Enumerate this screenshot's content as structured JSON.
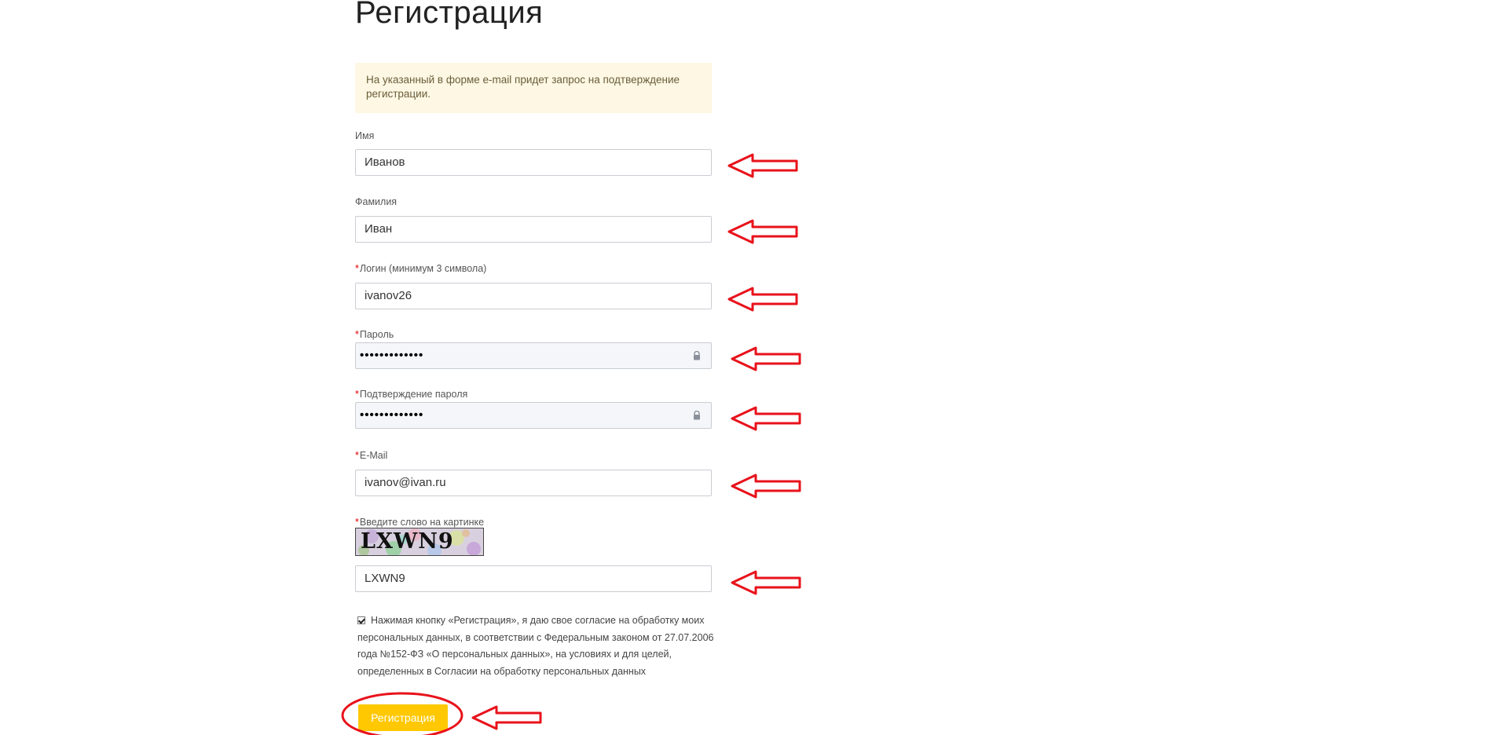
{
  "page": {
    "title": "Регистрация",
    "notice": "На указанный в форме e-mail придет запрос на подтверждение регистрации."
  },
  "form": {
    "fields": [
      {
        "label": "Имя",
        "required": false,
        "value": "Иванов",
        "type": "text"
      },
      {
        "label": "Фамилия",
        "required": false,
        "value": "Иван",
        "type": "text"
      },
      {
        "label": "Логин (минимум 3 символа)",
        "required": true,
        "value": "ivanov26",
        "type": "text"
      },
      {
        "label": "Пароль",
        "required": true,
        "value": "•••••••••••••",
        "type": "password"
      },
      {
        "label": "Подтверждение пароля",
        "required": true,
        "value": "•••••••••••••",
        "type": "password"
      },
      {
        "label": "E-Mail",
        "required": true,
        "value": "ivanov@ivan.ru",
        "type": "text"
      }
    ],
    "captcha": {
      "label": "Введите слово на картинке",
      "required": true,
      "image_text": "LXWN9",
      "value": "LXWN9"
    },
    "required_mark": "*",
    "consent": {
      "checked": true,
      "text": "Нажимая кнопку «Регистрация», я даю свое согласие на обработку моих персональных данных, в соответствии с Федеральным законом от 27.07.2006 года №152-ФЗ «О персональных данных», на условиях и для целей, определенных в Согласии на обработку персональных данных"
    },
    "submit_label": "Регистрация"
  },
  "colors": {
    "accent": "#ffc800",
    "notice_bg": "#fdf7e3",
    "annotation": "#e8121b",
    "required": "#e30000"
  }
}
